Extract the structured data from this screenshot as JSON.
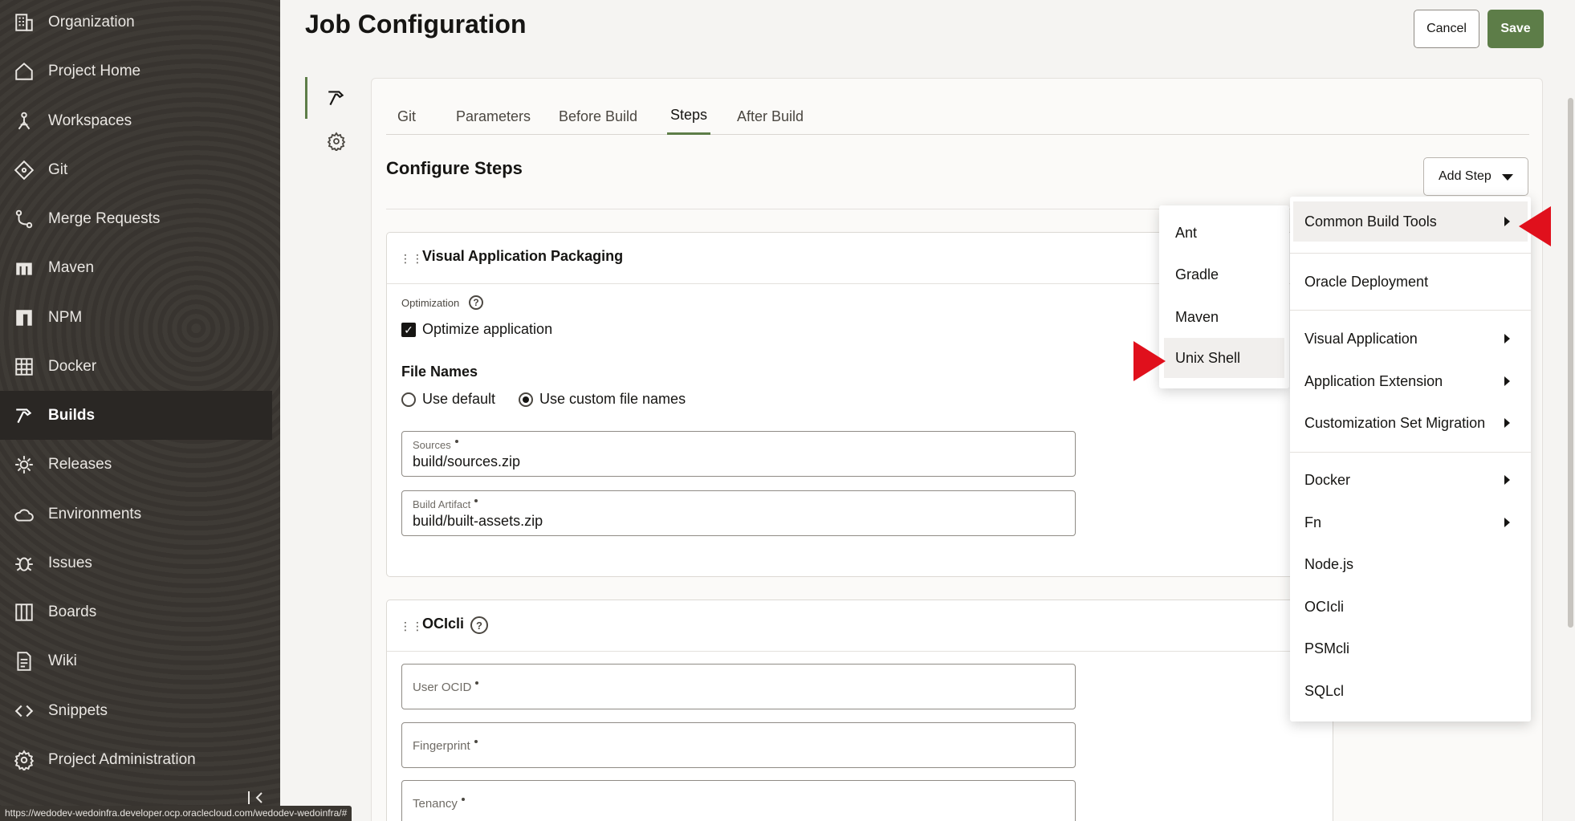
{
  "sidebar": {
    "items": [
      {
        "label": "Organization",
        "icon": "organization-icon"
      },
      {
        "label": "Project Home",
        "icon": "home-icon"
      },
      {
        "label": "Workspaces",
        "icon": "workspaces-icon"
      },
      {
        "label": "Git",
        "icon": "git-icon"
      },
      {
        "label": "Merge Requests",
        "icon": "merge-requests-icon"
      },
      {
        "label": "Maven",
        "icon": "maven-icon"
      },
      {
        "label": "NPM",
        "icon": "npm-icon"
      },
      {
        "label": "Docker",
        "icon": "docker-icon"
      },
      {
        "label": "Builds",
        "icon": "builds-icon",
        "active": true
      },
      {
        "label": "Releases",
        "icon": "releases-icon"
      },
      {
        "label": "Environments",
        "icon": "environments-icon"
      },
      {
        "label": "Issues",
        "icon": "issues-icon"
      },
      {
        "label": "Boards",
        "icon": "boards-icon"
      },
      {
        "label": "Wiki",
        "icon": "wiki-icon"
      },
      {
        "label": "Snippets",
        "icon": "snippets-icon"
      },
      {
        "label": "Project Administration",
        "icon": "gear-icon"
      }
    ]
  },
  "status_bar": {
    "url": "https://wedodev-wedoinfra.developer.ocp.oraclecloud.com/wedodev-wedoinfra/#"
  },
  "header": {
    "title": "Job Configuration",
    "cancel_label": "Cancel",
    "save_label": "Save"
  },
  "tabs": [
    {
      "label": "Git"
    },
    {
      "label": "Parameters"
    },
    {
      "label": "Before Build"
    },
    {
      "label": "Steps",
      "active": true
    },
    {
      "label": "After Build"
    }
  ],
  "steps": {
    "title": "Configure Steps",
    "add_step_label": "Add Step",
    "cards": [
      {
        "title": "Visual Application Packaging",
        "optimization_label": "Optimization",
        "optimize_checkbox_label": "Optimize application",
        "optimize_checked": true,
        "file_names_heading": "File Names",
        "radio_default_label": "Use default",
        "radio_custom_label": "Use custom file names",
        "radio_selected": "custom",
        "fields": [
          {
            "label": "Sources",
            "value": "build/sources.zip"
          },
          {
            "label": "Build Artifact",
            "value": "build/built-assets.zip"
          }
        ]
      },
      {
        "title": "OCIcli",
        "fields": [
          {
            "label": "User OCID",
            "value": ""
          },
          {
            "label": "Fingerprint",
            "value": ""
          },
          {
            "label": "Tenancy",
            "value": ""
          }
        ]
      }
    ]
  },
  "add_step_menu": {
    "items": [
      {
        "label": "Common Build Tools",
        "submenu": true,
        "highlighted": true
      },
      {
        "label": "Oracle Deployment"
      },
      {
        "label": "Visual Application",
        "submenu": true
      },
      {
        "label": "Application Extension",
        "submenu": true
      },
      {
        "label": "Customization Set Migration",
        "submenu": true
      },
      {
        "label": "Docker",
        "submenu": true
      },
      {
        "label": "Fn",
        "submenu": true
      },
      {
        "label": "Node.js"
      },
      {
        "label": "OCIcli"
      },
      {
        "label": "PSMcli"
      },
      {
        "label": "SQLcl"
      }
    ],
    "submenu_items": [
      {
        "label": "Ant"
      },
      {
        "label": "Gradle"
      },
      {
        "label": "Maven"
      },
      {
        "label": "Unix Shell",
        "highlighted": true
      }
    ]
  },
  "colors": {
    "accent": "#5d7d48",
    "sidebar_bg": "#3a3631",
    "annotation_arrow": "#e0101c"
  }
}
